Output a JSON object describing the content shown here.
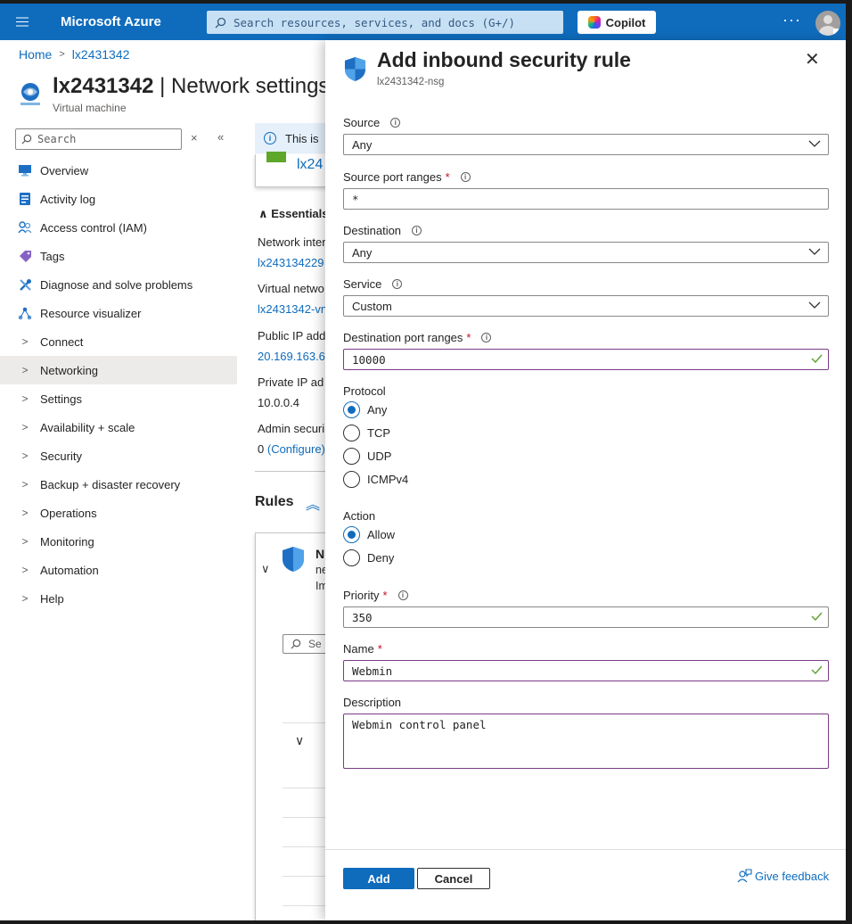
{
  "topbar": {
    "brand": "Microsoft Azure",
    "search_placeholder": "Search resources, services, and docs (G+/)",
    "copilot_label": "Copilot",
    "more_label": "···"
  },
  "breadcrumb": {
    "home": "Home",
    "resource": "lx2431342"
  },
  "resource": {
    "name": "lx2431342",
    "page": " | Network settings",
    "type": "Virtual machine"
  },
  "sidebar": {
    "search_placeholder": "Search",
    "clear_label": "×",
    "collapse_label": "«",
    "items": [
      {
        "label": "Overview",
        "icon": "monitor-icon"
      },
      {
        "label": "Activity log",
        "icon": "activity-log-icon"
      },
      {
        "label": "Access control (IAM)",
        "icon": "people-icon"
      },
      {
        "label": "Tags",
        "icon": "tag-icon"
      },
      {
        "label": "Diagnose and solve problems",
        "icon": "wrench-icon"
      },
      {
        "label": "Resource visualizer",
        "icon": "visualizer-icon"
      },
      {
        "label": "Connect",
        "icon": "chevron-right-icon"
      },
      {
        "label": "Networking",
        "icon": "chevron-right-icon"
      },
      {
        "label": "Settings",
        "icon": "chevron-right-icon"
      },
      {
        "label": "Availability + scale",
        "icon": "chevron-right-icon"
      },
      {
        "label": "Security",
        "icon": "chevron-right-icon"
      },
      {
        "label": "Backup + disaster recovery",
        "icon": "chevron-right-icon"
      },
      {
        "label": "Operations",
        "icon": "chevron-right-icon"
      },
      {
        "label": "Monitoring",
        "icon": "chevron-right-icon"
      },
      {
        "label": "Automation",
        "icon": "chevron-right-icon"
      },
      {
        "label": "Help",
        "icon": "chevron-right-icon"
      }
    ]
  },
  "main": {
    "info_text": "This is",
    "card_link": "lx24",
    "essentials": "Essentials",
    "fields": [
      {
        "label": "Network inter",
        "value": "lx243134229",
        "link": true
      },
      {
        "label": "Virtual netwo",
        "value": "lx2431342-vn",
        "link": true
      },
      {
        "label": "Public IP add",
        "value": "20.169.163.6",
        "link": true
      },
      {
        "label": "Private IP ad",
        "value": "10.0.0.4",
        "link": false
      },
      {
        "label": "Admin securi",
        "value": "0",
        "link": false
      }
    ],
    "configure_link": "(Configure)",
    "rules_heading": "Rules",
    "rule_card": {
      "title": "N",
      "line2": "ne",
      "line3": "Im",
      "search_text": "Se"
    }
  },
  "panel": {
    "title": "Add inbound security rule",
    "subtitle": "lx2431342-nsg",
    "close_label": "✕",
    "source": {
      "label": "Source",
      "value": "Any"
    },
    "source_ports": {
      "label": "Source port ranges",
      "value": "*"
    },
    "destination": {
      "label": "Destination",
      "value": "Any"
    },
    "service": {
      "label": "Service",
      "value": "Custom"
    },
    "dest_ports": {
      "label": "Destination port ranges",
      "value": "10000"
    },
    "protocol": {
      "label": "Protocol",
      "options": [
        "Any",
        "TCP",
        "UDP",
        "ICMPv4"
      ],
      "selected": "Any"
    },
    "action": {
      "label": "Action",
      "options": [
        "Allow",
        "Deny"
      ],
      "selected": "Allow"
    },
    "priority": {
      "label": "Priority",
      "value": "350"
    },
    "name": {
      "label": "Name",
      "value": "Webmin"
    },
    "description": {
      "label": "Description",
      "value": "Webmin control panel"
    },
    "required_mark": "*",
    "add_label": "Add",
    "cancel_label": "Cancel",
    "feedback_label": "Give feedback"
  },
  "colors": {
    "azure_blue": "#0f6cbd",
    "focus_border": "#7a3b87",
    "valid_check": "#5aa02c",
    "required": "#c50f1f"
  }
}
